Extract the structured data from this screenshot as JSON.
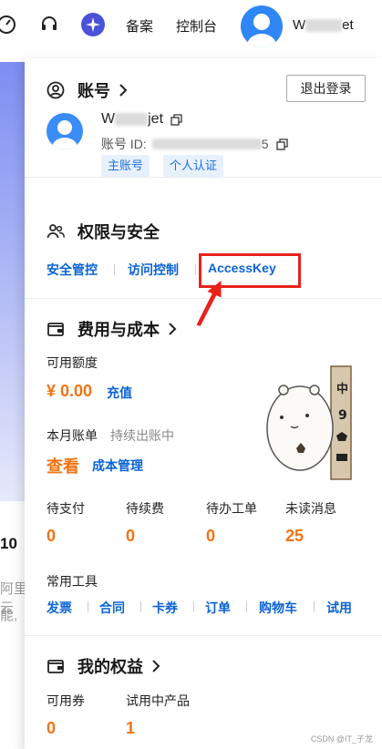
{
  "topbar": {
    "beian": "备案",
    "console": "控制台",
    "username_prefix": "W",
    "username_suffix": "et",
    "icons": [
      "speed-icon",
      "headset-icon",
      "brand-star-icon"
    ]
  },
  "background": {
    "number": "10",
    "line1": "阿里云",
    "line2": "能,"
  },
  "account": {
    "title": "账号",
    "logout_label": "退出登录",
    "name_prefix": "W",
    "name_suffix": "jet",
    "id_label": "账号 ID:",
    "id_suffix": "5",
    "tags": [
      "主账号",
      "个人认证"
    ]
  },
  "security": {
    "title": "权限与安全",
    "links": [
      "安全管控",
      "访问控制",
      "AccessKey"
    ]
  },
  "billing": {
    "title": "费用与成本",
    "available_label": "可用额度",
    "available_value": "¥ 0.00",
    "recharge": "充值",
    "bill_label": "本月账单",
    "bill_status": "持续出账中",
    "view": "查看",
    "cost_mgmt": "成本管理",
    "stats": [
      {
        "label": "待支付",
        "value": "0"
      },
      {
        "label": "待续费",
        "value": "0"
      },
      {
        "label": "待办工单",
        "value": "0"
      },
      {
        "label": "未读消息",
        "value": "25"
      }
    ],
    "tools_label": "常用工具",
    "tools": [
      "发票",
      "合同",
      "卡券",
      "订单",
      "购物车",
      "试用"
    ],
    "mascot_text": [
      "中",
      "9"
    ]
  },
  "benefits": {
    "title": "我的权益",
    "stats": [
      {
        "label": "可用券",
        "value": "0"
      },
      {
        "label": "试用中产品",
        "value": "1"
      }
    ]
  },
  "watermark": "CSDN @IT_子龙",
  "colors": {
    "accent": "#0b63d6",
    "orange": "#f27312",
    "highlight": "#e8221b"
  }
}
